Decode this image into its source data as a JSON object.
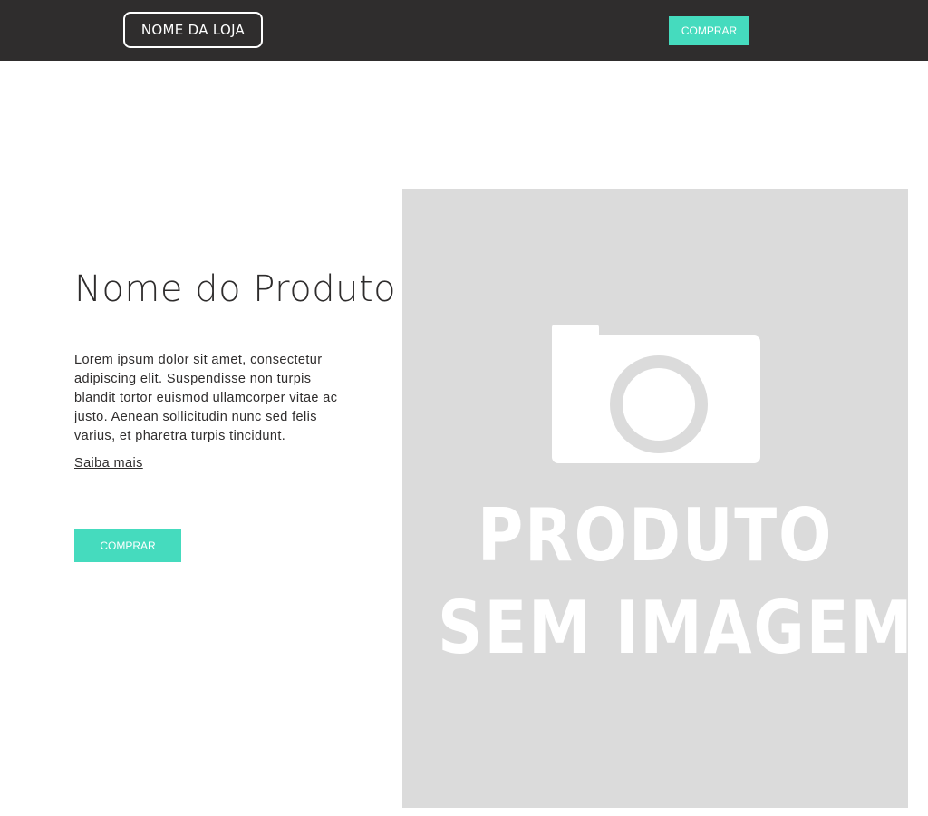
{
  "header": {
    "store_name": "NOME DA LOJA",
    "buy_label": "COMPRAR"
  },
  "product": {
    "title": "Nome do Produto",
    "description": "Lorem ipsum dolor sit amet, consectetur adipiscing elit. Suspendisse non turpis blandit tortor euismod ullamcorper vitae ac justo. Aenean sollicitudin nunc sed felis varius, et pharetra turpis tincidunt.",
    "learn_more": "Saiba mais",
    "buy_label": "COMPRAR",
    "image": {
      "icon": "camera-icon",
      "line1": "PRODUTO",
      "line2": "SEM IMAGEM"
    }
  },
  "colors": {
    "header_bg": "#2f2d2d",
    "accent": "#45dbbe",
    "image_placeholder_bg": "#dbdbdb",
    "text": "#2e2c2c"
  }
}
